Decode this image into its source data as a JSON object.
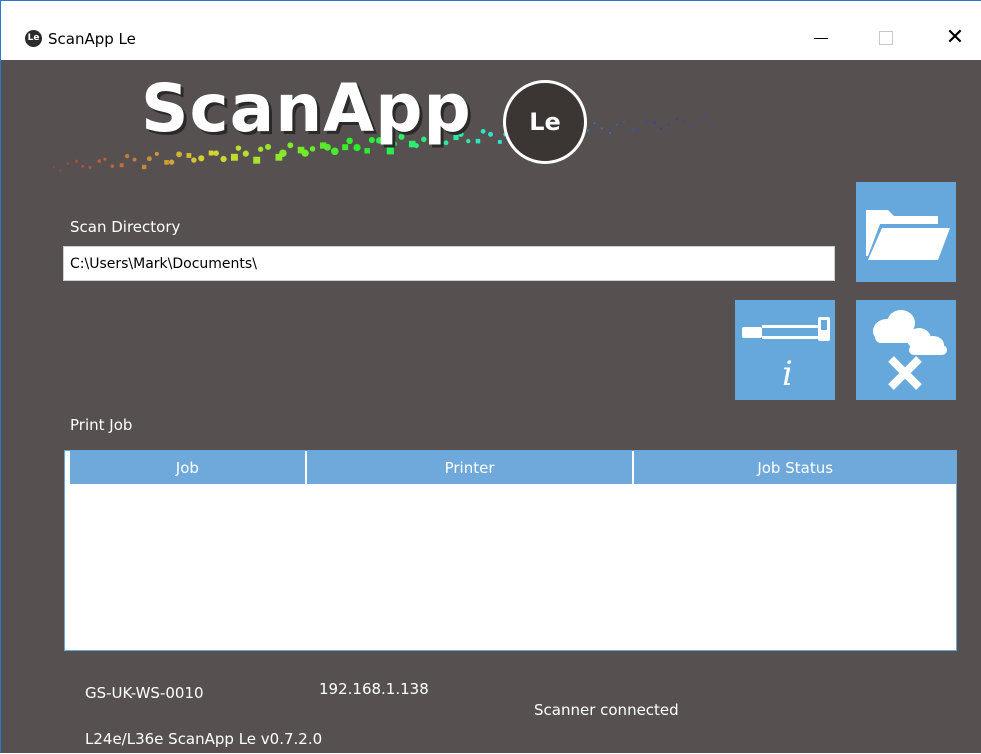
{
  "window": {
    "title": "ScanApp Le",
    "icon_text": "Le",
    "controls": {
      "minimize": "minimize-icon",
      "maximize": "maximize-icon",
      "close": "close-icon"
    }
  },
  "logo": {
    "text": "ScanApp",
    "badge": "Le"
  },
  "scan_directory": {
    "label": "Scan Directory",
    "value": "C:\\Users\\Mark\\Documents\\"
  },
  "actions": {
    "browse_icon": "folder-open-icon",
    "scanner_info_icon": "scanner-info-icon",
    "cloud_disconnect_icon": "cloud-disconnect-icon",
    "info_glyph": "i"
  },
  "print_job": {
    "label": "Print Job",
    "columns": [
      "Job",
      "Printer",
      "Job Status"
    ],
    "rows": []
  },
  "status": {
    "hostname": "GS-UK-WS-0010",
    "ip": "192.168.1.138",
    "scanner": "Scanner connected",
    "version": "L24e/L36e ScanApp Le v0.7.2.0"
  },
  "colors": {
    "background": "#565150",
    "accent": "#66a8dc",
    "titlebar": "#ffffff"
  }
}
